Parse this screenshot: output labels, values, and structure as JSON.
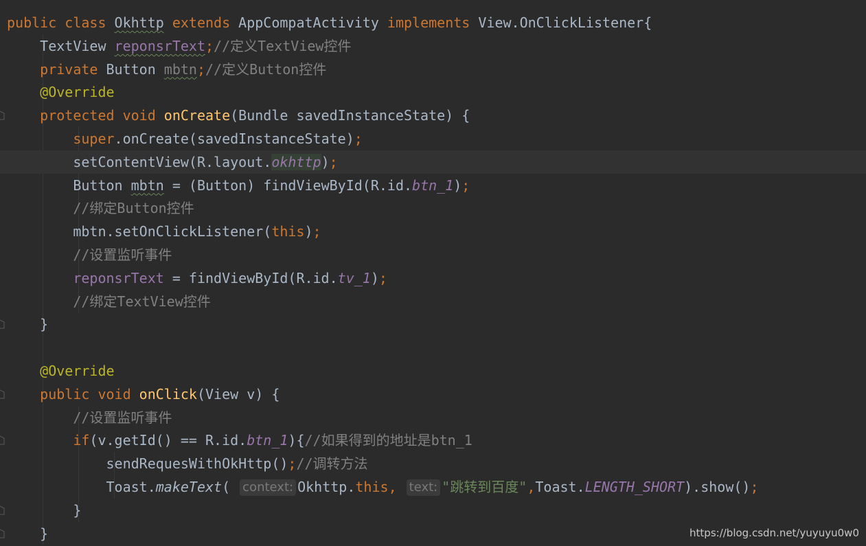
{
  "editor": {
    "background": "#2b2b2b",
    "lines": [
      [
        {
          "t": "public class ",
          "c": "kw"
        },
        {
          "t": "Okhttp",
          "c": "plain",
          "w": true
        },
        {
          "t": " extends ",
          "c": "kw"
        },
        {
          "t": "AppCompatActivity ",
          "c": "plain"
        },
        {
          "t": "implements ",
          "c": "kw"
        },
        {
          "t": "View.OnClickListener{",
          "c": "plain"
        }
      ],
      [
        {
          "t": "    TextView ",
          "c": "plain"
        },
        {
          "t": "reponsrText",
          "c": "field",
          "w": true
        },
        {
          "t": ";",
          "c": "kw"
        },
        {
          "t": "//定义TextView控件",
          "c": "cmt"
        }
      ],
      [
        {
          "t": "    private ",
          "c": "kw"
        },
        {
          "t": "Button ",
          "c": "plain"
        },
        {
          "t": "mbtn",
          "c": "cmt",
          "w": true
        },
        {
          "t": ";",
          "c": "kw"
        },
        {
          "t": "//定义Button控件",
          "c": "cmt"
        }
      ],
      [
        {
          "t": "    @Override",
          "c": "ann"
        }
      ],
      [
        {
          "t": "    protected void ",
          "c": "kw"
        },
        {
          "t": "onCreate",
          "c": "method"
        },
        {
          "t": "(Bundle savedInstanceState) {",
          "c": "plain"
        }
      ],
      [
        {
          "t": "        super",
          "c": "kw"
        },
        {
          "t": ".onCreate(savedInstanceState)",
          "c": "plain"
        },
        {
          "t": ";",
          "c": "kw"
        }
      ],
      [
        {
          "t": "        setContentView(R.layout.",
          "c": "plain"
        },
        {
          "t": "okhttp",
          "c": "ital",
          "hl": true
        },
        {
          "t": ")",
          "c": "plain"
        },
        {
          "t": ";",
          "c": "kw"
        }
      ],
      [
        {
          "t": "        Button ",
          "c": "plain"
        },
        {
          "t": "mbtn",
          "c": "plain",
          "w": true
        },
        {
          "t": " = (Button) findViewById(R.id.",
          "c": "plain"
        },
        {
          "t": "btn_1",
          "c": "ital"
        },
        {
          "t": ")",
          "c": "plain"
        },
        {
          "t": ";",
          "c": "kw"
        }
      ],
      [
        {
          "t": "        //绑定Button控件",
          "c": "cmt"
        }
      ],
      [
        {
          "t": "        mbtn.setOnClickListener(",
          "c": "plain"
        },
        {
          "t": "this",
          "c": "kw"
        },
        {
          "t": ")",
          "c": "plain"
        },
        {
          "t": ";",
          "c": "kw"
        }
      ],
      [
        {
          "t": "        //设置监听事件",
          "c": "cmt"
        }
      ],
      [
        {
          "t": "        ",
          "c": "plain"
        },
        {
          "t": "reponsrText",
          "c": "field"
        },
        {
          "t": " = findViewById(R.id.",
          "c": "plain"
        },
        {
          "t": "tv_1",
          "c": "ital"
        },
        {
          "t": ")",
          "c": "plain"
        },
        {
          "t": ";",
          "c": "kw"
        }
      ],
      [
        {
          "t": "        //绑定TextView控件",
          "c": "cmt"
        }
      ],
      [
        {
          "t": "    }",
          "c": "plain"
        }
      ],
      [],
      [
        {
          "t": "    @Override",
          "c": "ann"
        }
      ],
      [
        {
          "t": "    public void ",
          "c": "kw"
        },
        {
          "t": "onClick",
          "c": "method"
        },
        {
          "t": "(View v) {",
          "c": "plain"
        }
      ],
      [
        {
          "t": "        //设置监听事件",
          "c": "cmt"
        }
      ],
      [
        {
          "t": "        if",
          "c": "kw"
        },
        {
          "t": "(v.getId() == R.id.",
          "c": "plain"
        },
        {
          "t": "btn_1",
          "c": "ital"
        },
        {
          "t": "){",
          "c": "plain"
        },
        {
          "t": "//如果得到的地址是btn_1",
          "c": "cmt"
        }
      ],
      [
        {
          "t": "            sendRequesWithOkHttp()",
          "c": "plain"
        },
        {
          "t": ";",
          "c": "kw"
        },
        {
          "t": "//调转方法",
          "c": "cmt"
        }
      ],
      [
        {
          "t": "            Toast.",
          "c": "plain"
        },
        {
          "t": "makeText",
          "c": "ital-plain"
        },
        {
          "t": "( ",
          "c": "plain"
        },
        {
          "t": "context:",
          "c": "hint"
        },
        {
          "t": "Okhttp.",
          "c": "plain"
        },
        {
          "t": "this",
          "c": "kw"
        },
        {
          "t": ", ",
          "c": "kw"
        },
        {
          "t": "text:",
          "c": "hint"
        },
        {
          "t": "\"跳转到百度\"",
          "c": "str"
        },
        {
          "t": ",",
          "c": "kw"
        },
        {
          "t": "Toast.",
          "c": "plain"
        },
        {
          "t": "LENGTH_SHORT",
          "c": "ital"
        },
        {
          "t": ").show()",
          "c": "plain"
        },
        {
          "t": ";",
          "c": "kw"
        }
      ],
      [
        {
          "t": "        }",
          "c": "plain"
        }
      ],
      [
        {
          "t": "    }",
          "c": "plain"
        }
      ]
    ]
  },
  "watermark": "https://blog.csdn.net/yuyuyu0w0"
}
